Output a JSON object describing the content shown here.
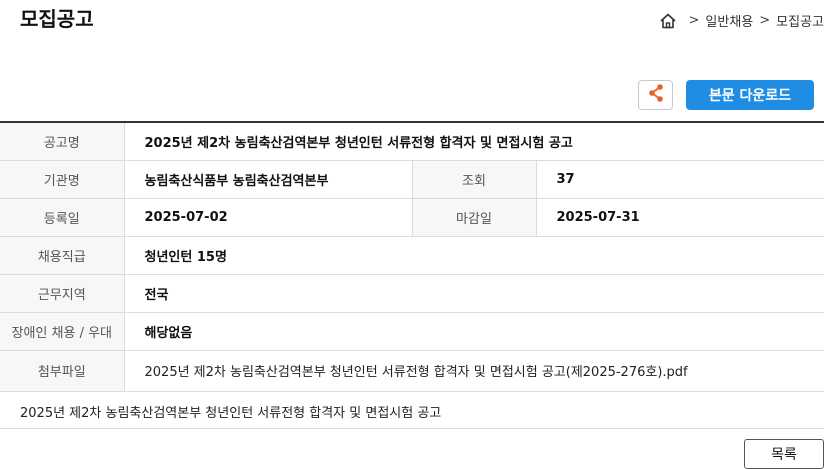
{
  "page": {
    "title": "모집공고"
  },
  "breadcrumb": {
    "items": [
      "일반채용",
      "모집공고"
    ],
    "separator": ">"
  },
  "toolbar": {
    "share_icon": "share-icon",
    "download_label": "본문 다운로드",
    "accent_color": "#1f8de3",
    "share_color": "#e8612c"
  },
  "info": {
    "title_label": "공고명",
    "title_value": "2025년 제2차 농림축산검역본부 청년인턴 서류전형 합격자 및 면접시험 공고",
    "org_label": "기관명",
    "org_value": "농림축산식품부 농림축산검역본부",
    "views_label": "조회",
    "views_value": "37",
    "reg_label": "등록일",
    "reg_value": "2025-07-02",
    "deadline_label": "마감일",
    "deadline_value": "2025-07-31",
    "position_label": "채용직급",
    "position_value": "청년인턴 15명",
    "region_label": "근무지역",
    "region_value": "전국",
    "disabled_label": "장애인 채용 / 우대",
    "disabled_value": "해당없음",
    "file_label": "첨부파일",
    "file_value": "2025년 제2차 농림축산검역본부 청년인턴 서류전형 합격자 및 면접시험 공고(제2025-276호).pdf"
  },
  "body": {
    "text": "2025년 제2차 농림축산검역본부 청년인턴 서류전형 합격자 및 면접시험 공고"
  },
  "footer": {
    "list_label": "목록"
  }
}
